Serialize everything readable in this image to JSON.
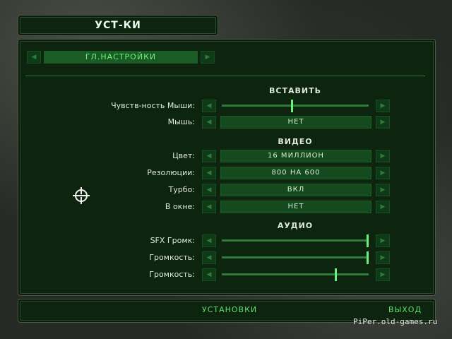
{
  "title": "УСТ-КИ",
  "menu": {
    "label": "ГЛ.НАСТРОЙКИ",
    "prev_icon": "left-arrow-icon",
    "next_icon": "right-arrow-icon"
  },
  "sections": {
    "input": "ВСТАВИТЬ",
    "video": "ВИДЕО",
    "audio": "АУДИО"
  },
  "settings": {
    "mouse_sensitivity": {
      "label": "Чувств-ность Мыши:",
      "level": 0.48
    },
    "mouse": {
      "label": "Мышь:",
      "value": "НЕТ"
    },
    "color": {
      "label": "Цвет:",
      "value": "16 МИЛЛИОН"
    },
    "resolution": {
      "label": "Резолюции:",
      "value": "800 НА 600"
    },
    "turbo": {
      "label": "Турбо:",
      "value": "ВКЛ"
    },
    "windowed": {
      "label": "В окне:",
      "value": "НЕТ"
    },
    "sfx_volume": {
      "label": "SFX Громк:",
      "level": 1.0
    },
    "volume_1": {
      "label": "Громкость:",
      "level": 1.0
    },
    "volume_2": {
      "label": "Громкость:",
      "level": 0.78
    }
  },
  "bottom": {
    "install": "УСТАНОВКИ",
    "exit": "ВЫХОД"
  },
  "watermark": "PiPer.old-games.ru",
  "colors": {
    "panel": "#0d240f",
    "accent": "#6cf07c",
    "value_box": "#154a1f"
  }
}
